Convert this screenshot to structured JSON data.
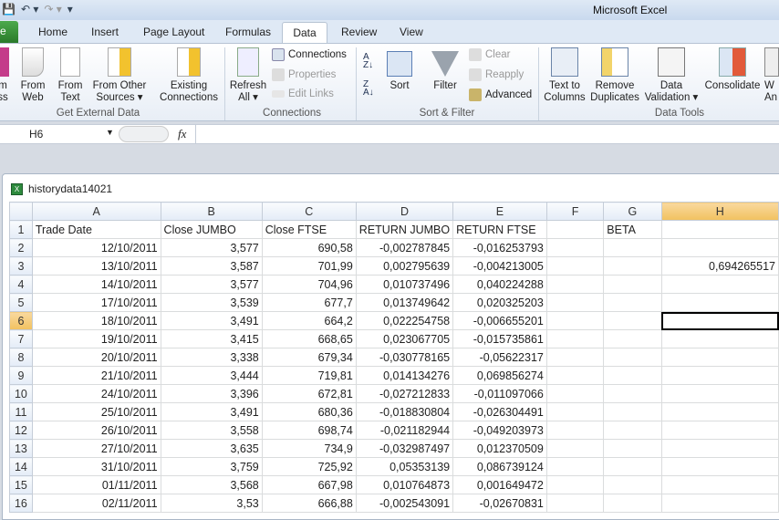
{
  "app_title": "Microsoft Excel",
  "qat": {
    "save": "💾",
    "undo": "↶ ▾",
    "redo": "↷ ▾",
    "customize": "▾"
  },
  "tabs": {
    "file": "e",
    "home": "Home",
    "insert": "Insert",
    "page_layout": "Page Layout",
    "formulas": "Formulas",
    "data": "Data",
    "review": "Review",
    "view": "View"
  },
  "ribbon": {
    "get_external": {
      "access": "m\nss",
      "web": "From\nWeb",
      "text": "From\nText",
      "other": "From Other\nSources ▾",
      "existing": "Existing\nConnections",
      "label": "Get External Data"
    },
    "connections": {
      "refresh": "Refresh\nAll ▾",
      "connections": "Connections",
      "properties": "Properties",
      "edit_links": "Edit Links",
      "label": "Connections"
    },
    "sort_filter": {
      "sort": "Sort",
      "filter": "Filter",
      "clear": "Clear",
      "reapply": "Reapply",
      "advanced": "Advanced",
      "label": "Sort & Filter"
    },
    "data_tools": {
      "text_to_columns": "Text to\nColumns",
      "remove_duplicates": "Remove\nDuplicates",
      "data_validation": "Data\nValidation ▾",
      "consolidate": "Consolidate",
      "whatif": "W\nAn",
      "label": "Data Tools"
    }
  },
  "formula_bar": {
    "name_box": "H6",
    "fx": "fx",
    "formula": ""
  },
  "workbook": {
    "title": "historydata14021"
  },
  "grid": {
    "columns": [
      "A",
      "B",
      "C",
      "D",
      "E",
      "F",
      "G",
      "H"
    ],
    "selected_col": "H",
    "selected_row": 6,
    "rows": [
      [
        "Trade Date",
        "Close JUMBO",
        "Close FTSE",
        "RETURN JUMBO",
        "RETURN FTSE",
        "",
        "BETA",
        ""
      ],
      [
        "12/10/2011",
        "3,577",
        "690,58",
        "-0,002787845",
        "-0,016253793",
        "",
        "",
        ""
      ],
      [
        "13/10/2011",
        "3,587",
        "701,99",
        "0,002795639",
        "-0,004213005",
        "",
        "",
        "0,694265517"
      ],
      [
        "14/10/2011",
        "3,577",
        "704,96",
        "0,010737496",
        "0,040224288",
        "",
        "",
        ""
      ],
      [
        "17/10/2011",
        "3,539",
        "677,7",
        "0,013749642",
        "0,020325203",
        "",
        "",
        ""
      ],
      [
        "18/10/2011",
        "3,491",
        "664,2",
        "0,022254758",
        "-0,006655201",
        "",
        "",
        ""
      ],
      [
        "19/10/2011",
        "3,415",
        "668,65",
        "0,023067705",
        "-0,015735861",
        "",
        "",
        ""
      ],
      [
        "20/10/2011",
        "3,338",
        "679,34",
        "-0,030778165",
        "-0,05622317",
        "",
        "",
        ""
      ],
      [
        "21/10/2011",
        "3,444",
        "719,81",
        "0,014134276",
        "0,069856274",
        "",
        "",
        ""
      ],
      [
        "24/10/2011",
        "3,396",
        "672,81",
        "-0,027212833",
        "-0,011097066",
        "",
        "",
        ""
      ],
      [
        "25/10/2011",
        "3,491",
        "680,36",
        "-0,018830804",
        "-0,026304491",
        "",
        "",
        ""
      ],
      [
        "26/10/2011",
        "3,558",
        "698,74",
        "-0,021182944",
        "-0,049203973",
        "",
        "",
        ""
      ],
      [
        "27/10/2011",
        "3,635",
        "734,9",
        "-0,032987497",
        "0,012370509",
        "",
        "",
        ""
      ],
      [
        "31/10/2011",
        "3,759",
        "725,92",
        "0,05353139",
        "0,086739124",
        "",
        "",
        ""
      ],
      [
        "01/11/2011",
        "3,568",
        "667,98",
        "0,010764873",
        "0,001649472",
        "",
        "",
        ""
      ],
      [
        "02/11/2011",
        "3,53",
        "666,88",
        "-0,002543091",
        "-0,02670831",
        "",
        "",
        ""
      ]
    ]
  }
}
